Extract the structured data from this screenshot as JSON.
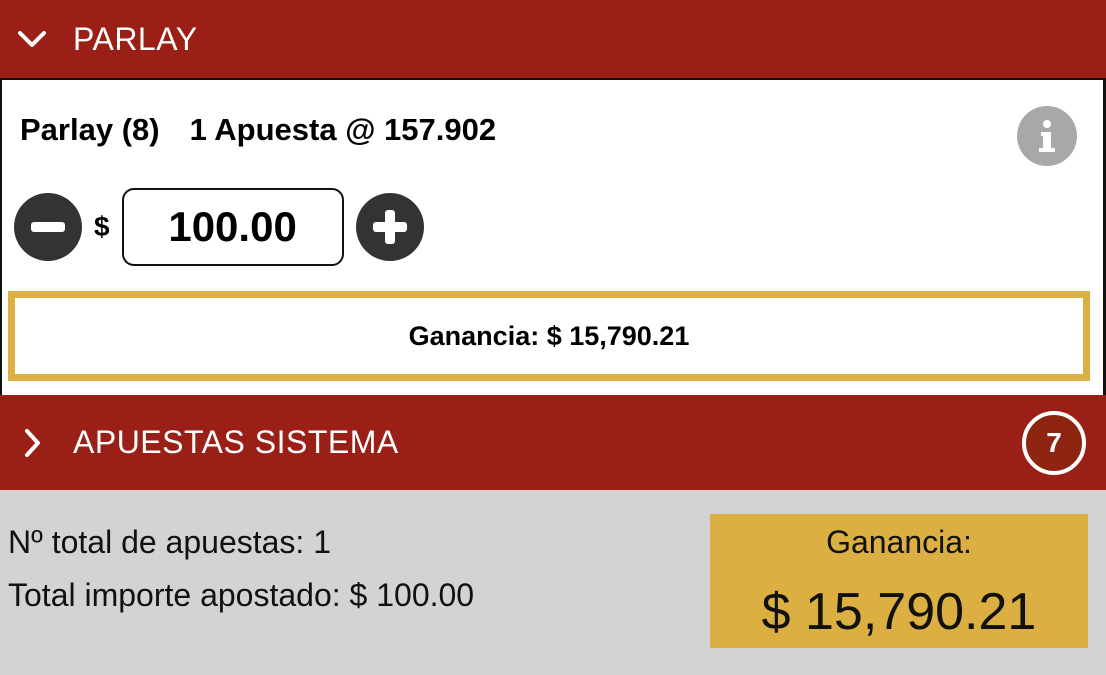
{
  "parlay_section": {
    "title": "PARLAY",
    "chevron_icon": "chevron-down-icon",
    "parlay_label": "Parlay (8)",
    "bet_summary": "1 Apuesta @ 157.902",
    "info_icon": "info-icon",
    "stake": {
      "currency": "$",
      "value": "100.00",
      "decrease_icon": "minus-circle-icon",
      "increase_icon": "plus-circle-icon"
    },
    "gain_text": "Ganancia: $ 15,790.21"
  },
  "sistema_section": {
    "title": "APUESTAS SISTEMA",
    "chevron_icon": "chevron-right-icon",
    "badge_count": "7"
  },
  "summary": {
    "total_bets": "Nº total de apuestas: 1",
    "total_staked": "Total importe apostado: $ 100.00",
    "gain_label": "Ganancia:",
    "gain_value": "$ 15,790.21"
  },
  "colors": {
    "header_red": "#9a1f16",
    "gold": "#dcaf42",
    "summary_gray": "#d3d3d3",
    "button_dark": "#333333",
    "info_gray": "#a8a8a8"
  }
}
